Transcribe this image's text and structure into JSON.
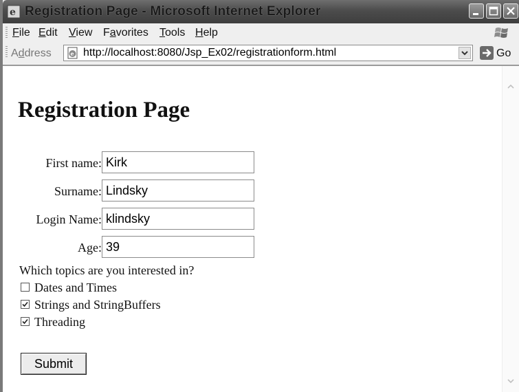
{
  "window": {
    "title": "Registration Page - Microsoft Internet Explorer"
  },
  "menu": {
    "items": [
      {
        "label": "File",
        "accel": "F",
        "rest": "ile"
      },
      {
        "label": "Edit",
        "accel": "E",
        "rest": "dit"
      },
      {
        "label": "View",
        "accel": "V",
        "rest": "iew"
      },
      {
        "label": "Favorites",
        "pre": "F",
        "accel": "a",
        "rest": "vorites"
      },
      {
        "label": "Tools",
        "accel": "T",
        "rest": "ools"
      },
      {
        "label": "Help",
        "accel": "H",
        "rest": "elp"
      }
    ]
  },
  "address": {
    "label_pre": "A",
    "label_accel": "d",
    "label_rest": "dress",
    "url": "http://localhost:8080/Jsp_Ex02/registrationform.html",
    "go_label": "Go"
  },
  "page": {
    "heading": "Registration Page",
    "fields": [
      {
        "label": "First name:",
        "value": "Kirk"
      },
      {
        "label": "Surname:",
        "value": "Lindsky"
      },
      {
        "label": "Login Name:",
        "value": "klindsky"
      },
      {
        "label": "Age:",
        "value": "39"
      }
    ],
    "question": "Which topics are you interested in?",
    "topics": [
      {
        "label": "Dates and Times",
        "checked": false
      },
      {
        "label": "Strings and StringBuffers",
        "checked": true
      },
      {
        "label": "Threading",
        "checked": true
      }
    ],
    "submit_label": "Submit"
  },
  "icons": {
    "app": "ie-logo-icon",
    "throbber": "windows-flag-icon",
    "page": "ie-page-icon",
    "go": "go-arrow-icon"
  }
}
